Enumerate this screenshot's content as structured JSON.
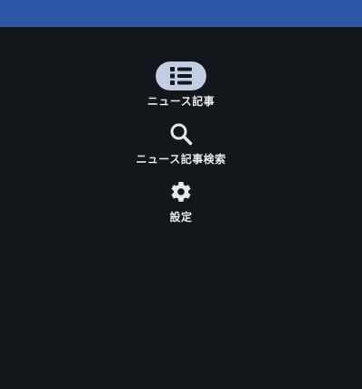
{
  "navigation": {
    "items": [
      {
        "label": "ニュース記事",
        "icon": "list-icon",
        "active": true
      },
      {
        "label": "ニュース記事検索",
        "icon": "search-icon",
        "active": false
      },
      {
        "label": "設定",
        "icon": "gear-icon",
        "active": false
      }
    ]
  },
  "colors": {
    "top_bar": "#2c56a6",
    "background": "#13161b",
    "active_indicator": "#c0cde2",
    "label_text": "#e6e8ec",
    "icon": "#e6e8ec",
    "active_icon": "#13161b"
  }
}
